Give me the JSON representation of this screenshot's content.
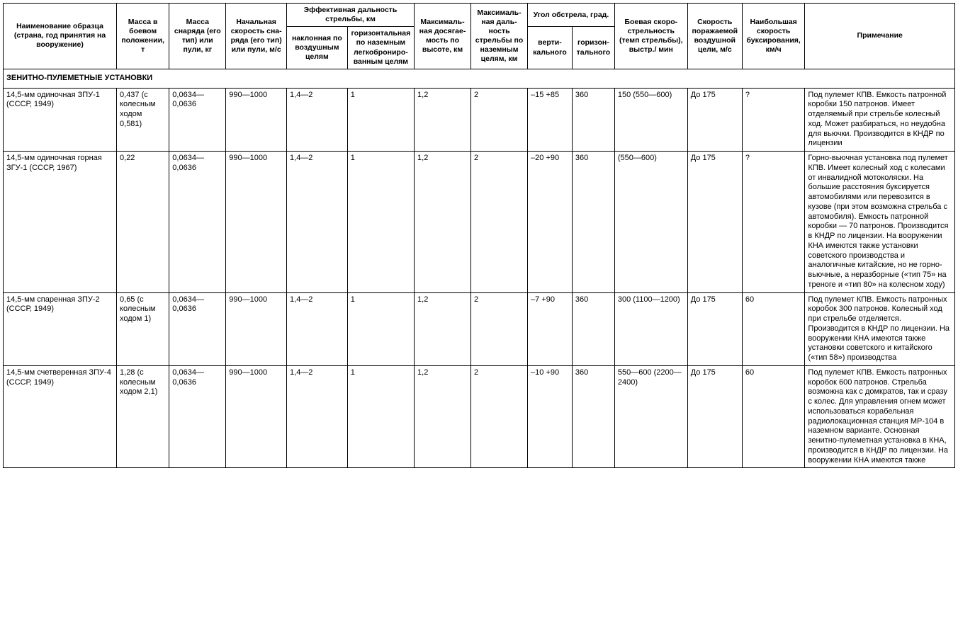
{
  "headers": {
    "name": "Наименование образца (страна, год принятия на вооружение)",
    "mass": "Масса в боевом положении, т",
    "shell": "Масса снаряда (его тип) или пули, кг",
    "vel": "Начальная скорость сна­ряда (его тип) или пули, м/с",
    "range_group": "Эффективная дальность стрельбы, км",
    "range_slant": "наклонная по воздушным целям",
    "range_horiz": "горизонтальная по наземным легкоброниро­ванным целям",
    "alt": "Максималь­ная досягае­мость по высоте, км",
    "max_ground": "Максималь­ная даль­ность стрельбы по наземным целям, км",
    "fof_group": "Угол обстрела, град.",
    "fof_vert": "верти­кального",
    "fof_horz": "горизон­тального",
    "rof": "Боевая скоро­стрельность (темп стрельбы), выстр./ мин",
    "tspd": "Скорость поражаемой воздушной цели, м/с",
    "tow": "Наибольшая скорость буксирования, км/ч",
    "note": "Примечание"
  },
  "section_title": "ЗЕНИТНО-ПУЛЕМЕТНЫЕ УСТАНОВКИ",
  "rows": [
    {
      "name": "14,5-мм одиночная ЗПУ-1 (СССР, 1949)",
      "mass": "0,437 (с колесным ходом 0,581)",
      "shell": "0,0634—0,0636",
      "vel": "990—1000",
      "r1": "1,4—2",
      "r2": "1",
      "alt": "1,2",
      "maxgnd": "2",
      "vert": "–15 +85",
      "horz": "360",
      "rof": "150 (550—600)",
      "tspd": "До 175",
      "tow": "?",
      "note": "Под пулемет КПВ. Емкость па­тронной коробки 150 патронов. Имеет отделяемый при стрельбе колесный ход. Может разбирать­ся, но неудобна для вьючки. Производится в КНДР по лицензии"
    },
    {
      "name": "14,5-мм одиночная горная ЗГУ-1 (СССР, 1967)",
      "mass": "0,22",
      "shell": "0,0634—0,0636",
      "vel": "990—1000",
      "r1": "1,4—2",
      "r2": "1",
      "alt": "1,2",
      "maxgnd": "2",
      "vert": "–20 +90",
      "horz": "360",
      "rof": "(550—600)",
      "tspd": "До 175",
      "tow": "?",
      "note": "Горно-вьючная установка под пулемет КПВ. Имеет колесный ход с колесами от инвалидной мотоколяски. На большие рас­стояния буксируется автомоби­лями или перевозится в кузове (при этом возможна стрельба с автомобиля). Емкость патронной коробки — 70 патронов. Произ­водится в КНДР по лицензии. На вооружении КНА имеются также установки советского производства и аналогичные китайские, но не горно-вьюч­ные, а неразборные («тип 75» на треноге и «тип 80» на колес­ном ходу)"
    },
    {
      "name": "14,5-мм спаренная ЗПУ-2 (СССР, 1949)",
      "mass": "0,65 (с колесным ходом 1)",
      "shell": "0,0634—0,0636",
      "vel": "990—1000",
      "r1": "1,4—2",
      "r2": "1",
      "alt": "1,2",
      "maxgnd": "2",
      "vert": "–7 +90",
      "horz": "360",
      "rof": "300 (1100—1200)",
      "tspd": "До 175",
      "tow": "60",
      "note": "Под пулемет КПВ. Емкость па­тронных коробок 300 патронов. Колесный ход при стрельбе отделяется. Производится в КНДР по лицензии. На вооруже­нии КНА имеются также установ­ки советского и китайского («тип 58») производства"
    },
    {
      "name": "14,5-мм счетверенная ЗПУ-4 (СССР, 1949)",
      "mass": "1,28 (с колесным ходом 2,1)",
      "shell": "0,0634—0,0636",
      "vel": "990—1000",
      "r1": "1,4—2",
      "r2": "1",
      "alt": "1,2",
      "maxgnd": "2",
      "vert": "–10 +90",
      "horz": "360",
      "rof": "550—600 (2200—2400)",
      "tspd": "До 175",
      "tow": "60",
      "note": "Под пулемет КПВ. Емкость па­тронных коробок 600 патронов. Стрельба возможна как с дом­кратов, так и сразу с колес. Для управления огнем может использоваться корабельная радиолокационная станция МР-104 в наземном варианте. Основная зенитно-пулеметная установка в КНА, производится в КНДР по лицензии. На воору­жении КНА имеются также"
    }
  ]
}
